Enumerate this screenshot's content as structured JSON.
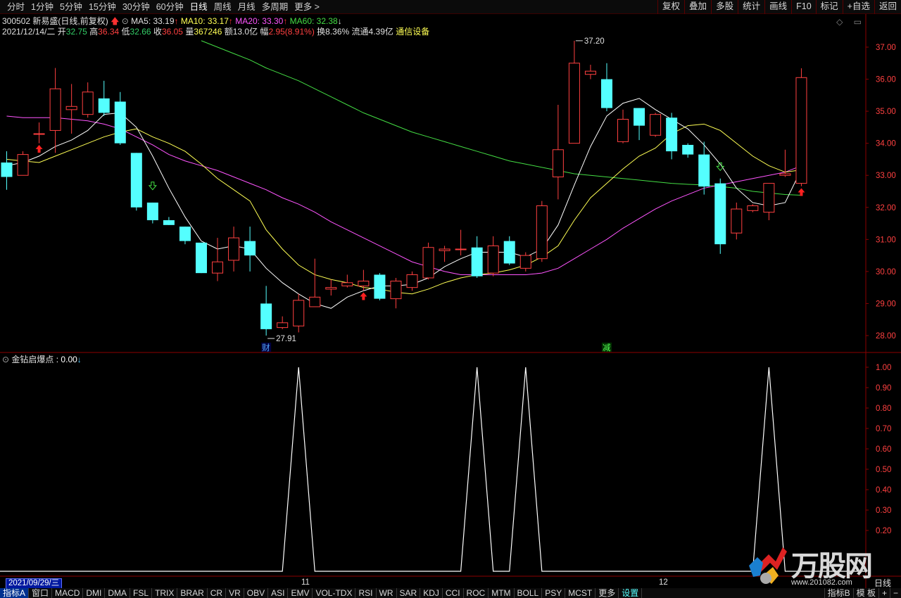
{
  "toolbar": {
    "periods": [
      "分时",
      "1分钟",
      "5分钟",
      "15分钟",
      "30分钟",
      "60分钟",
      "日线",
      "周线",
      "月线",
      "多周期",
      "更多 >"
    ],
    "active_period": "日线",
    "right_buttons": [
      "复权",
      "叠加",
      "多股",
      "统计",
      "画线",
      "F10",
      "标记",
      "+自选",
      "返回"
    ]
  },
  "stock": {
    "code_name": "300502 新易盛(日线,前复权)",
    "ma5": "MA5: 33.19",
    "ma10": "MA10: 33.17",
    "ma20": "MA20: 33.30",
    "ma60": "MA60: 32.38",
    "date": "2021/12/14/二",
    "open_label": "开",
    "open": "32.75",
    "high_label": "高",
    "high": "36.34",
    "low_label": "低",
    "low": "32.66",
    "close_label": "收",
    "close": "36.05",
    "volume_label": "量",
    "volume": "367246",
    "amount": "额13.0亿",
    "change_label": "幅",
    "change": "2.95(8.91%)",
    "turnover": "换8.36%",
    "float_cap": "流通4.39亿",
    "sector": "通信设备"
  },
  "price_axis": [
    "37.00",
    "36.00",
    "35.00",
    "34.00",
    "33.00",
    "32.00",
    "31.00",
    "30.00",
    "29.00",
    "28.00"
  ],
  "annotations": {
    "high_mark": "37.20",
    "low_mark": "27.91",
    "badge_cai": "财",
    "badge_jian": "减"
  },
  "indicator": {
    "title": "金钻启爆点",
    "value": ": 0.00",
    "axis": [
      "1.00",
      "0.90",
      "0.80",
      "0.70",
      "0.60",
      "0.50",
      "0.40",
      "0.30",
      "0.20"
    ]
  },
  "date_bar": {
    "start_date": "2021/09/29/三",
    "month_11": "11",
    "month_12": "12",
    "right_label": "日线"
  },
  "bottom_tabs": [
    "指标A",
    "窗口",
    "MACD",
    "DMI",
    "DMA",
    "FSL",
    "TRIX",
    "BRAR",
    "CR",
    "VR",
    "OBV",
    "ASI",
    "EMV",
    "VOL-TDX",
    "RSI",
    "WR",
    "SAR",
    "KDJ",
    "CCI",
    "ROC",
    "MTM",
    "BOLL",
    "PSY",
    "MCST",
    "更多",
    "设置"
  ],
  "bottom_right": [
    "指标B",
    "模 板",
    "+",
    "−"
  ],
  "watermark": {
    "title": "万股网",
    "url": "www.201082.com"
  },
  "colors": {
    "up": "#ff4040",
    "down": "#54ffff",
    "ma5": "#ffffff",
    "ma10": "#ffff54",
    "ma20": "#ff55ff",
    "ma60": "#44dd44",
    "grid": "#8b0000"
  },
  "chart_data": {
    "type": "candlestick",
    "y_range": [
      27.6,
      37.6
    ],
    "candles": [
      {
        "o": 33.4,
        "h": 33.75,
        "l": 32.55,
        "c": 32.95
      },
      {
        "o": 33.0,
        "h": 33.75,
        "l": 33.0,
        "c": 33.65
      },
      {
        "o": 34.3,
        "h": 34.65,
        "l": 34.0,
        "c": 34.3
      },
      {
        "o": 34.4,
        "h": 36.35,
        "l": 33.7,
        "c": 35.7
      },
      {
        "o": 35.05,
        "h": 35.85,
        "l": 34.3,
        "c": 35.15
      },
      {
        "o": 34.9,
        "h": 35.9,
        "l": 34.8,
        "c": 35.6
      },
      {
        "o": 35.4,
        "h": 35.95,
        "l": 34.85,
        "c": 34.95
      },
      {
        "o": 35.3,
        "h": 35.6,
        "l": 33.95,
        "c": 34.0
      },
      {
        "o": 33.7,
        "h": 33.7,
        "l": 31.9,
        "c": 32.0
      },
      {
        "o": 32.15,
        "h": 32.15,
        "l": 31.5,
        "c": 31.6
      },
      {
        "o": 31.6,
        "h": 31.7,
        "l": 31.45,
        "c": 31.45
      },
      {
        "o": 31.4,
        "h": 31.4,
        "l": 30.85,
        "c": 30.95
      },
      {
        "o": 30.9,
        "h": 30.9,
        "l": 29.95,
        "c": 29.95
      },
      {
        "o": 29.95,
        "h": 31.05,
        "l": 29.7,
        "c": 30.3
      },
      {
        "o": 30.35,
        "h": 31.4,
        "l": 30.0,
        "c": 31.05
      },
      {
        "o": 30.95,
        "h": 31.4,
        "l": 30.0,
        "c": 30.5
      },
      {
        "o": 29.0,
        "h": 29.55,
        "l": 28.0,
        "c": 28.2
      },
      {
        "o": 28.25,
        "h": 28.6,
        "l": 28.2,
        "c": 28.4
      },
      {
        "o": 28.3,
        "h": 29.3,
        "l": 28.1,
        "c": 29.1
      },
      {
        "o": 28.9,
        "h": 30.4,
        "l": 28.9,
        "c": 29.2
      },
      {
        "o": 29.45,
        "h": 29.75,
        "l": 29.25,
        "c": 29.5
      },
      {
        "o": 29.55,
        "h": 29.9,
        "l": 29.5,
        "c": 29.65
      },
      {
        "o": 29.55,
        "h": 30.05,
        "l": 29.4,
        "c": 29.7
      },
      {
        "o": 29.9,
        "h": 29.95,
        "l": 29.1,
        "c": 29.15
      },
      {
        "o": 29.15,
        "h": 29.8,
        "l": 28.85,
        "c": 29.7
      },
      {
        "o": 29.5,
        "h": 30.0,
        "l": 29.4,
        "c": 29.9
      },
      {
        "o": 29.8,
        "h": 30.9,
        "l": 29.75,
        "c": 30.75
      },
      {
        "o": 30.65,
        "h": 30.8,
        "l": 30.3,
        "c": 30.7
      },
      {
        "o": 30.7,
        "h": 31.3,
        "l": 30.5,
        "c": 30.7
      },
      {
        "o": 30.75,
        "h": 31.1,
        "l": 29.8,
        "c": 29.85
      },
      {
        "o": 29.95,
        "h": 31.1,
        "l": 29.85,
        "c": 30.8
      },
      {
        "o": 30.95,
        "h": 31.1,
        "l": 30.2,
        "c": 30.25
      },
      {
        "o": 30.1,
        "h": 30.6,
        "l": 30.0,
        "c": 30.5
      },
      {
        "o": 30.4,
        "h": 32.2,
        "l": 30.3,
        "c": 32.05
      },
      {
        "o": 32.95,
        "h": 35.2,
        "l": 32.25,
        "c": 33.8
      },
      {
        "o": 34.0,
        "h": 37.2,
        "l": 34.0,
        "c": 36.5
      },
      {
        "o": 36.15,
        "h": 36.45,
        "l": 36.0,
        "c": 36.25
      },
      {
        "o": 36.0,
        "h": 36.5,
        "l": 35.0,
        "c": 35.1
      },
      {
        "o": 34.05,
        "h": 35.05,
        "l": 34.0,
        "c": 34.75
      },
      {
        "o": 35.1,
        "h": 35.1,
        "l": 34.1,
        "c": 34.55
      },
      {
        "o": 34.25,
        "h": 34.95,
        "l": 34.2,
        "c": 34.9
      },
      {
        "o": 34.8,
        "h": 34.95,
        "l": 33.5,
        "c": 33.75
      },
      {
        "o": 33.95,
        "h": 34.0,
        "l": 33.55,
        "c": 33.65
      },
      {
        "o": 33.65,
        "h": 34.05,
        "l": 32.4,
        "c": 32.65
      },
      {
        "o": 32.75,
        "h": 32.9,
        "l": 30.55,
        "c": 30.85
      },
      {
        "o": 31.2,
        "h": 32.15,
        "l": 31.0,
        "c": 31.95
      },
      {
        "o": 31.9,
        "h": 32.1,
        "l": 31.85,
        "c": 32.05
      },
      {
        "o": 31.85,
        "h": 32.25,
        "l": 31.6,
        "c": 32.75
      },
      {
        "o": 33.0,
        "h": 33.8,
        "l": 32.95,
        "c": 33.05
      },
      {
        "o": 32.75,
        "h": 36.34,
        "l": 32.66,
        "c": 36.05
      }
    ],
    "ma5": [
      33.3,
      33.4,
      33.6,
      33.9,
      34.1,
      34.4,
      34.9,
      34.95,
      34.5,
      33.6,
      32.6,
      31.7,
      30.95,
      30.7,
      30.8,
      30.7,
      30.1,
      29.65,
      29.3,
      29.0,
      28.85,
      29.2,
      29.4,
      29.55,
      29.55,
      29.6,
      29.8,
      30.15,
      30.4,
      30.6,
      30.6,
      30.6,
      30.45,
      30.7,
      31.45,
      32.7,
      33.9,
      34.85,
      35.25,
      35.4,
      35.05,
      34.75,
      34.45,
      33.95,
      33.35,
      32.6,
      32.15,
      32.05,
      32.15,
      33.19
    ],
    "ma10": [
      33.5,
      33.45,
      33.4,
      33.6,
      33.8,
      34.0,
      34.2,
      34.35,
      34.45,
      34.2,
      34.0,
      33.75,
      33.35,
      32.9,
      32.55,
      32.2,
      31.3,
      30.7,
      30.2,
      29.9,
      29.75,
      29.65,
      29.5,
      29.45,
      29.35,
      29.3,
      29.45,
      29.65,
      29.8,
      29.9,
      29.95,
      30.05,
      30.2,
      30.45,
      30.8,
      31.6,
      32.3,
      32.75,
      33.2,
      33.6,
      33.85,
      34.3,
      34.55,
      34.6,
      34.4,
      34.0,
      33.6,
      33.3,
      33.1,
      33.17
    ],
    "ma20": [
      34.85,
      34.8,
      34.8,
      34.8,
      34.75,
      34.7,
      34.6,
      34.45,
      34.2,
      33.95,
      33.65,
      33.45,
      33.3,
      33.15,
      32.95,
      32.75,
      32.55,
      32.3,
      32.1,
      31.85,
      31.55,
      31.3,
      31.05,
      30.8,
      30.55,
      30.3,
      30.15,
      30.0,
      29.9,
      29.9,
      29.9,
      29.9,
      29.9,
      29.95,
      30.1,
      30.4,
      30.7,
      31.0,
      31.35,
      31.65,
      31.95,
      32.2,
      32.4,
      32.6,
      32.7,
      32.8,
      32.9,
      33.0,
      33.1,
      33.3
    ],
    "ma60": [
      null,
      null,
      null,
      null,
      null,
      null,
      null,
      null,
      null,
      null,
      null,
      null,
      37.2,
      37.0,
      36.8,
      36.6,
      36.35,
      36.15,
      35.95,
      35.7,
      35.45,
      35.2,
      34.95,
      34.75,
      34.55,
      34.35,
      34.2,
      34.05,
      33.9,
      33.75,
      33.6,
      33.45,
      33.35,
      33.25,
      33.15,
      33.05,
      33.0,
      32.95,
      32.9,
      32.85,
      32.8,
      32.75,
      32.72,
      32.7,
      32.65,
      32.6,
      32.5,
      32.45,
      32.4,
      32.38
    ],
    "indicator_peaks": [
      18,
      29,
      32,
      47
    ],
    "indicator_range": [
      0,
      1
    ]
  }
}
